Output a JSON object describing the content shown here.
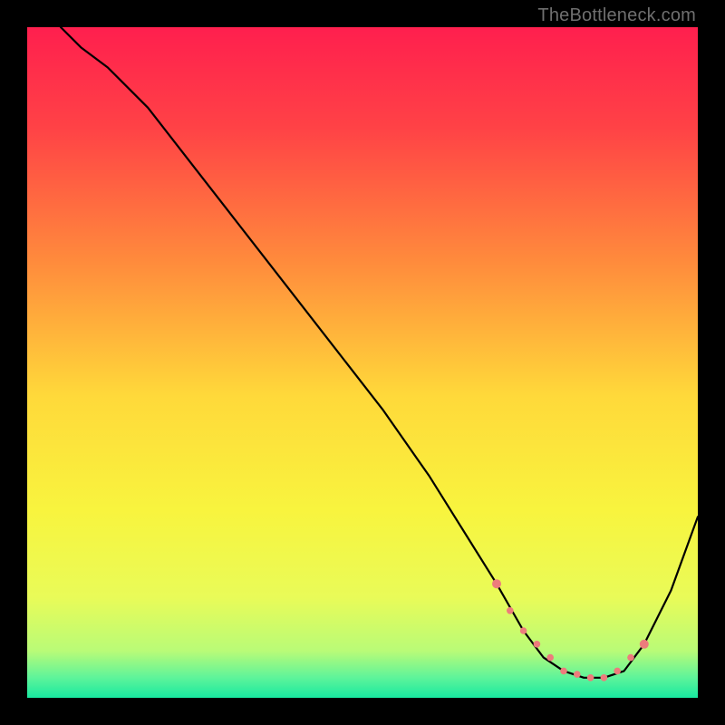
{
  "watermark": "TheBottleneck.com",
  "colors": {
    "frame": "#000000",
    "gradient_stops": [
      {
        "offset": 0.0,
        "color": "#ff1f4e"
      },
      {
        "offset": 0.15,
        "color": "#ff4246"
      },
      {
        "offset": 0.35,
        "color": "#ff8b3c"
      },
      {
        "offset": 0.55,
        "color": "#ffd93a"
      },
      {
        "offset": 0.72,
        "color": "#f8f43e"
      },
      {
        "offset": 0.85,
        "color": "#e9fb58"
      },
      {
        "offset": 0.93,
        "color": "#b9fb77"
      },
      {
        "offset": 0.97,
        "color": "#5ef49a"
      },
      {
        "offset": 1.0,
        "color": "#18e9a0"
      }
    ],
    "curve": "#000000",
    "markers": "#ed7c7c"
  },
  "chart_data": {
    "type": "line",
    "title": "",
    "xlabel": "",
    "ylabel": "",
    "xlim": [
      0,
      100
    ],
    "ylim": [
      0,
      100
    ],
    "note": "Axes unlabeled in source image. x/y normalized 0–100; y=0 at bottom (green), y=100 at top (red). Curve traced from pixels.",
    "series": [
      {
        "name": "bottleneck-curve",
        "x": [
          5,
          8,
          12,
          18,
          25,
          32,
          39,
          46,
          53,
          60,
          65,
          70,
          74,
          77,
          80,
          83,
          86,
          89,
          92,
          96,
          100
        ],
        "y": [
          100,
          97,
          94,
          88,
          79,
          70,
          61,
          52,
          43,
          33,
          25,
          17,
          10,
          6,
          4,
          3,
          3,
          4,
          8,
          16,
          27
        ]
      }
    ],
    "markers": {
      "name": "highlight-range",
      "x": [
        70,
        72,
        74,
        76,
        78,
        80,
        82,
        84,
        86,
        88,
        90,
        92
      ],
      "y": [
        17,
        13,
        10,
        8,
        6,
        4,
        3.5,
        3,
        3,
        4,
        6,
        8
      ]
    }
  }
}
